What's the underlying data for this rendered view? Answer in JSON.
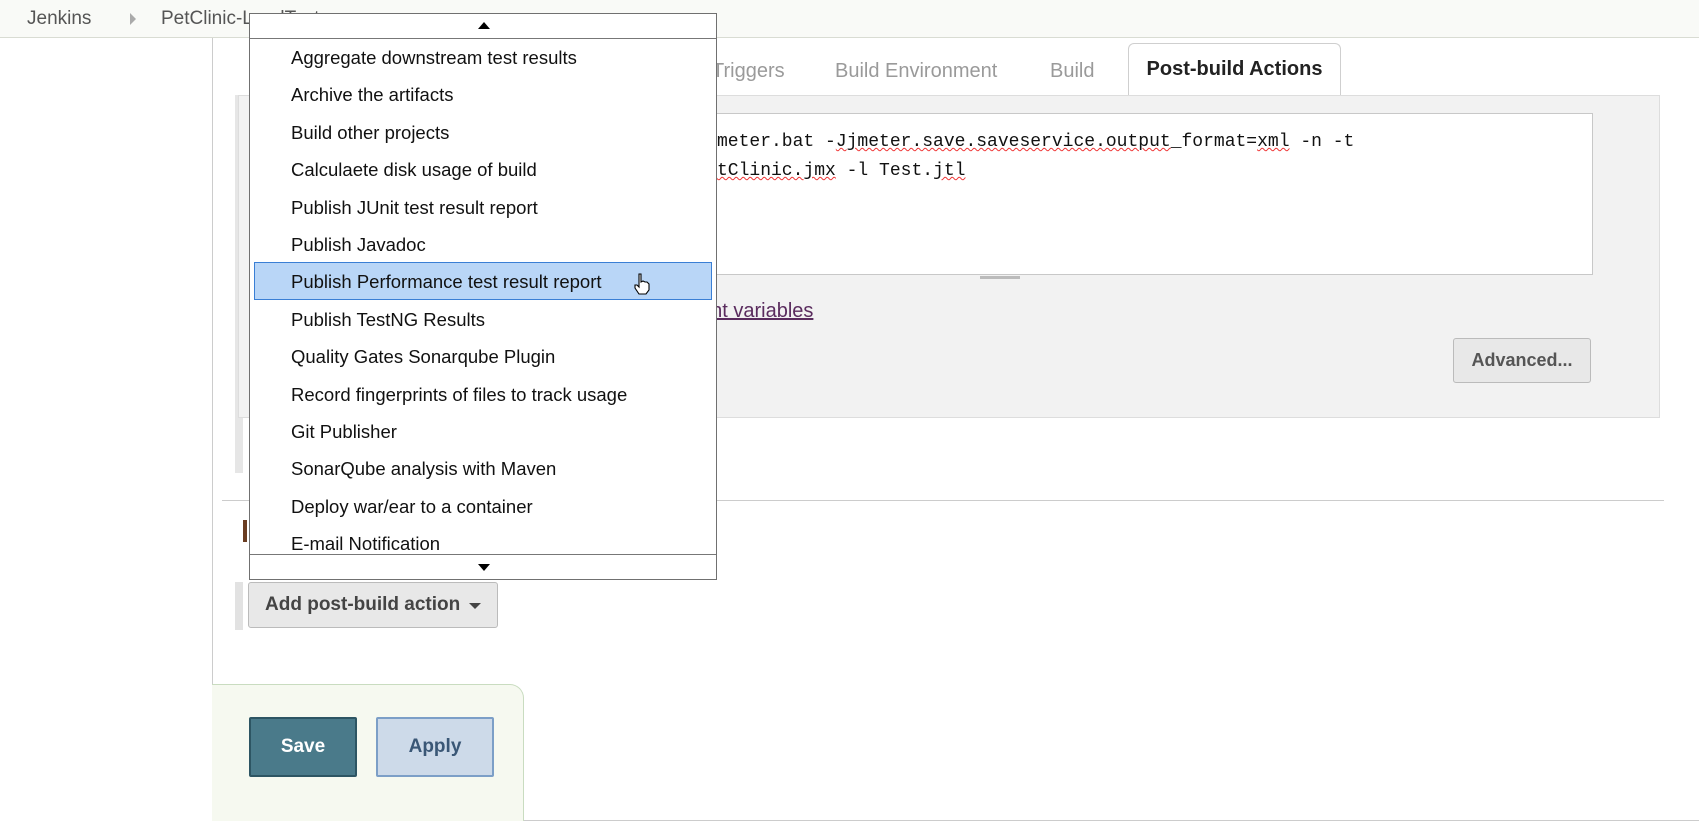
{
  "breadcrumb": {
    "items": [
      "Jenkins",
      "PetClinic-LoadTest"
    ]
  },
  "tabs": [
    "Triggers",
    "Build Environment",
    "Build",
    "Post-build Actions"
  ],
  "active_tab": "Post-build Actions",
  "command": {
    "line1": "meter.bat -Jjmeter.save.saveservice.output_format=xml -n -t",
    "line2": "tClinic.jmx -l Test.jtl"
  },
  "env_link": "ent variables",
  "advanced_label": "Advanced...",
  "add_post_build_label": "Add post-build action",
  "save_label": "Save",
  "apply_label": "Apply",
  "dropdown": {
    "items": [
      "Aggregate downstream test results",
      "Archive the artifacts",
      "Build other projects",
      "Calculaete disk usage of build",
      "Publish JUnit test result report",
      "Publish Javadoc",
      "Publish Performance test result report",
      "Publish TestNG Results",
      "Quality Gates Sonarqube Plugin",
      "Record fingerprints of files to track usage",
      "Git Publisher",
      "SonarQube analysis with Maven",
      "Deploy war/ear to a container",
      "E-mail Notification"
    ],
    "selected": "Publish Performance test result report"
  },
  "colors": {
    "accent": "#4a7a8a",
    "selection": "#b9d6f7"
  }
}
